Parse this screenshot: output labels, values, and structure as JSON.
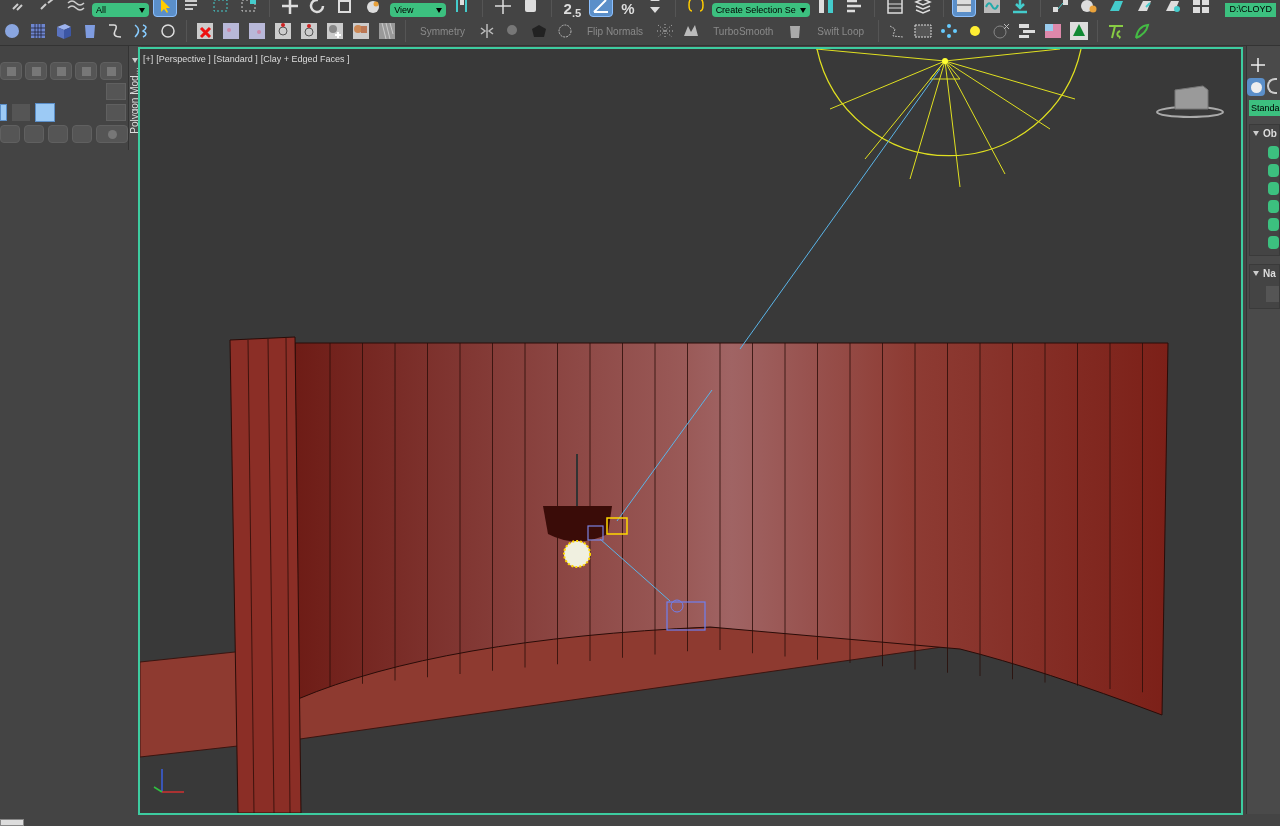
{
  "main_toolbar": {
    "selection_filter": "All",
    "reference_coordinate": "View",
    "snap_label": "2$_{.5}$",
    "percent_snap": "%",
    "named_selection": "Create Selection Se",
    "project_folder": "D:\\CLOYD"
  },
  "ribbon": {
    "tools": [
      {
        "label": "Symmetry",
        "disabled": true
      },
      {
        "label": "Flip Normals",
        "disabled": true
      },
      {
        "label": "TurboSmooth",
        "disabled": true
      },
      {
        "label": "Swift Loop",
        "disabled": true
      }
    ]
  },
  "left_panel": {
    "tab_label": "Polygon Mod..."
  },
  "viewport": {
    "labels": [
      "[+]",
      "[Perspective ]",
      "[Standard ]",
      "[Clay + Edged Faces ]"
    ],
    "active": true
  },
  "command_panel": {
    "category": "Standa",
    "rollouts": [
      {
        "title": "Ob",
        "expanded": true
      },
      {
        "title": "Na",
        "expanded": true
      }
    ]
  }
}
